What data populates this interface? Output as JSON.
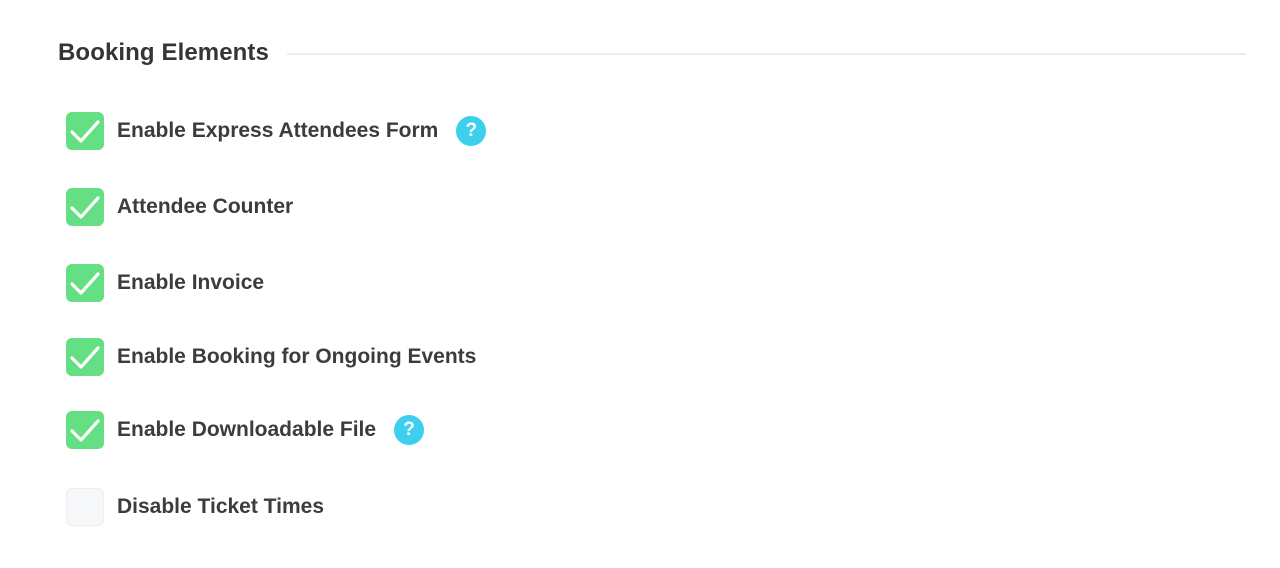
{
  "section": {
    "title": "Booking Elements"
  },
  "help_glyph": "?",
  "colors": {
    "checked": "#64df83",
    "help": "#3cd0ee",
    "unchecked": "#f7f8fa"
  },
  "options": [
    {
      "label": "Enable Express Attendees Form",
      "checked": true,
      "help": true
    },
    {
      "label": "Attendee Counter",
      "checked": true,
      "help": false
    },
    {
      "label": "Enable Invoice",
      "checked": true,
      "help": false
    },
    {
      "label": "Enable Booking for Ongoing Events",
      "checked": true,
      "help": false
    },
    {
      "label": "Enable Downloadable File",
      "checked": true,
      "help": true
    },
    {
      "label": "Disable Ticket Times",
      "checked": false,
      "help": false
    }
  ]
}
